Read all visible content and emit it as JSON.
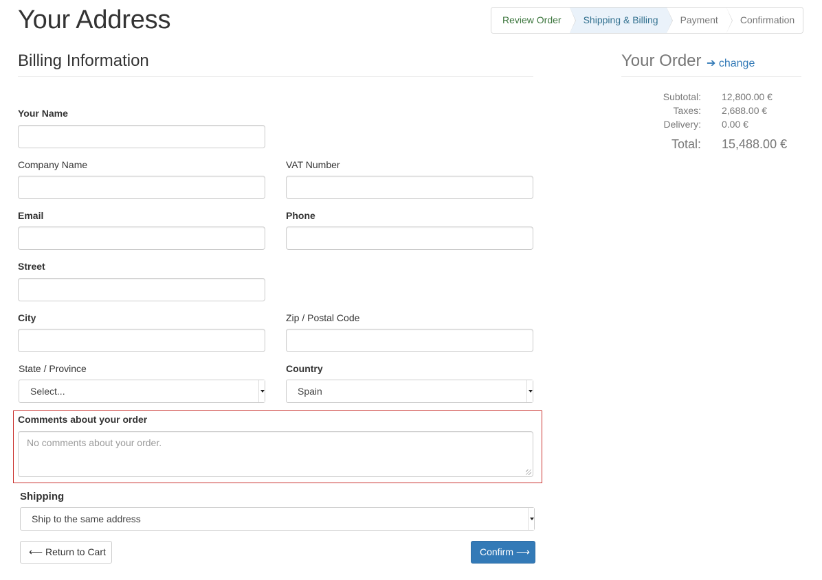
{
  "page": {
    "title": "Your Address"
  },
  "wizard": {
    "steps": [
      {
        "label": "Review Order",
        "state": "done"
      },
      {
        "label": "Shipping & Billing",
        "state": "active"
      },
      {
        "label": "Payment",
        "state": "todo"
      },
      {
        "label": "Confirmation",
        "state": "todo"
      }
    ]
  },
  "billing": {
    "title": "Billing Information",
    "name_label": "Your Name",
    "company_label": "Company Name",
    "vat_label": "VAT Number",
    "email_label": "Email",
    "phone_label": "Phone",
    "street_label": "Street",
    "city_label": "City",
    "zip_label": "Zip / Postal Code",
    "state_label": "State / Province",
    "state_value": "Select...",
    "country_label": "Country",
    "country_value": "Spain",
    "comments_label": "Comments about your order",
    "comments_placeholder": "No comments about your order."
  },
  "shipping": {
    "label": "Shipping",
    "value": "Ship to the same address"
  },
  "actions": {
    "back_label": "Return to Cart",
    "back_icon": "⟵",
    "confirm_label": "Confirm",
    "confirm_icon": "⟶"
  },
  "order": {
    "title": "Your Order",
    "change_icon": "➔",
    "change_label": "change",
    "subtotal_label": "Subtotal:",
    "subtotal_value": "12,800.00 €",
    "taxes_label": "Taxes:",
    "taxes_value": "2,688.00 €",
    "delivery_label": "Delivery:",
    "delivery_value": "0.00 €",
    "total_label": "Total:",
    "total_value": "15,488.00 €"
  },
  "colors": {
    "primary": "#337ab7",
    "done_step": "#3c763d",
    "active_step": "#31708f",
    "highlight_border": "#c9302c"
  }
}
